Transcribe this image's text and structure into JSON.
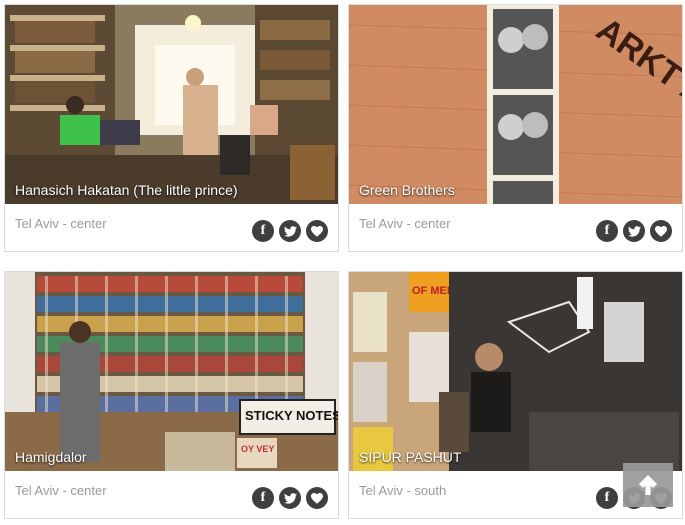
{
  "cards": [
    {
      "title": "Hanasich Hakatan (The little prince)",
      "location": "Tel Aviv - center"
    },
    {
      "title": "Green Brothers",
      "location": "Tel Aviv - center"
    },
    {
      "title": "Hamigdalor",
      "location": "Tel Aviv - center"
    },
    {
      "title": "SIPUR PASHUT",
      "location": "Tel Aviv - south"
    }
  ],
  "photo_text": {
    "sticky_notes": "STICKY NOTES",
    "oy_vey": "OY VEY",
    "of_men": "OF MEN",
    "stamp": "ARKT ALLE UN"
  },
  "icons": {
    "facebook": "facebook-icon",
    "twitter": "twitter-icon",
    "heart": "heart-icon",
    "back_to_top": "arrow-up-icon"
  },
  "colors": {
    "social_bg": "#3f3f3f",
    "location_text": "#9a9a9a",
    "back_top_bg": "#999999"
  }
}
